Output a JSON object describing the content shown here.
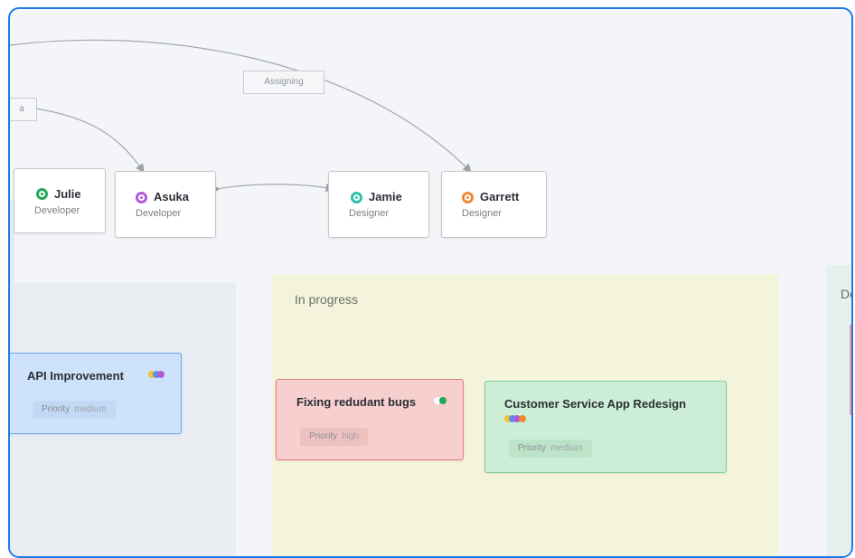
{
  "edge_labels": {
    "left_partial": "a",
    "assigning": "Assigning"
  },
  "people": [
    {
      "name": "Julie",
      "role": "Developer",
      "color": "#23a85a"
    },
    {
      "name": "Asuka",
      "role": "Developer",
      "color": "#b05ad9"
    },
    {
      "name": "Jamie",
      "role": "Designer",
      "color": "#2fc1a6"
    },
    {
      "name": "Garrett",
      "role": "Designer",
      "color": "#f08a32"
    }
  ],
  "columns": {
    "in_progress": "In progress",
    "done_partial": "Do"
  },
  "cards": {
    "api": {
      "title": "API Improvement",
      "priority_label": "Priority",
      "priority": "medium"
    },
    "bugs": {
      "title": "Fixing redudant bugs",
      "priority_label": "Priority",
      "priority": "high"
    },
    "customer": {
      "title": "Customer Service App Redesign",
      "priority_label": "Priority",
      "priority": "medium"
    }
  },
  "colors": {
    "frame_border": "#1e7be6",
    "api_card_bg": "#cfe2fb",
    "api_card_border": "#6aa6ee",
    "bugs_card_bg": "#f7cfcf",
    "bugs_card_border": "#e57b7b",
    "customer_card_bg": "#cdeed6",
    "customer_card_border": "#7fce96",
    "in_progress_bg": "#f4f4dd",
    "done_bg": "#e6f0ef"
  }
}
